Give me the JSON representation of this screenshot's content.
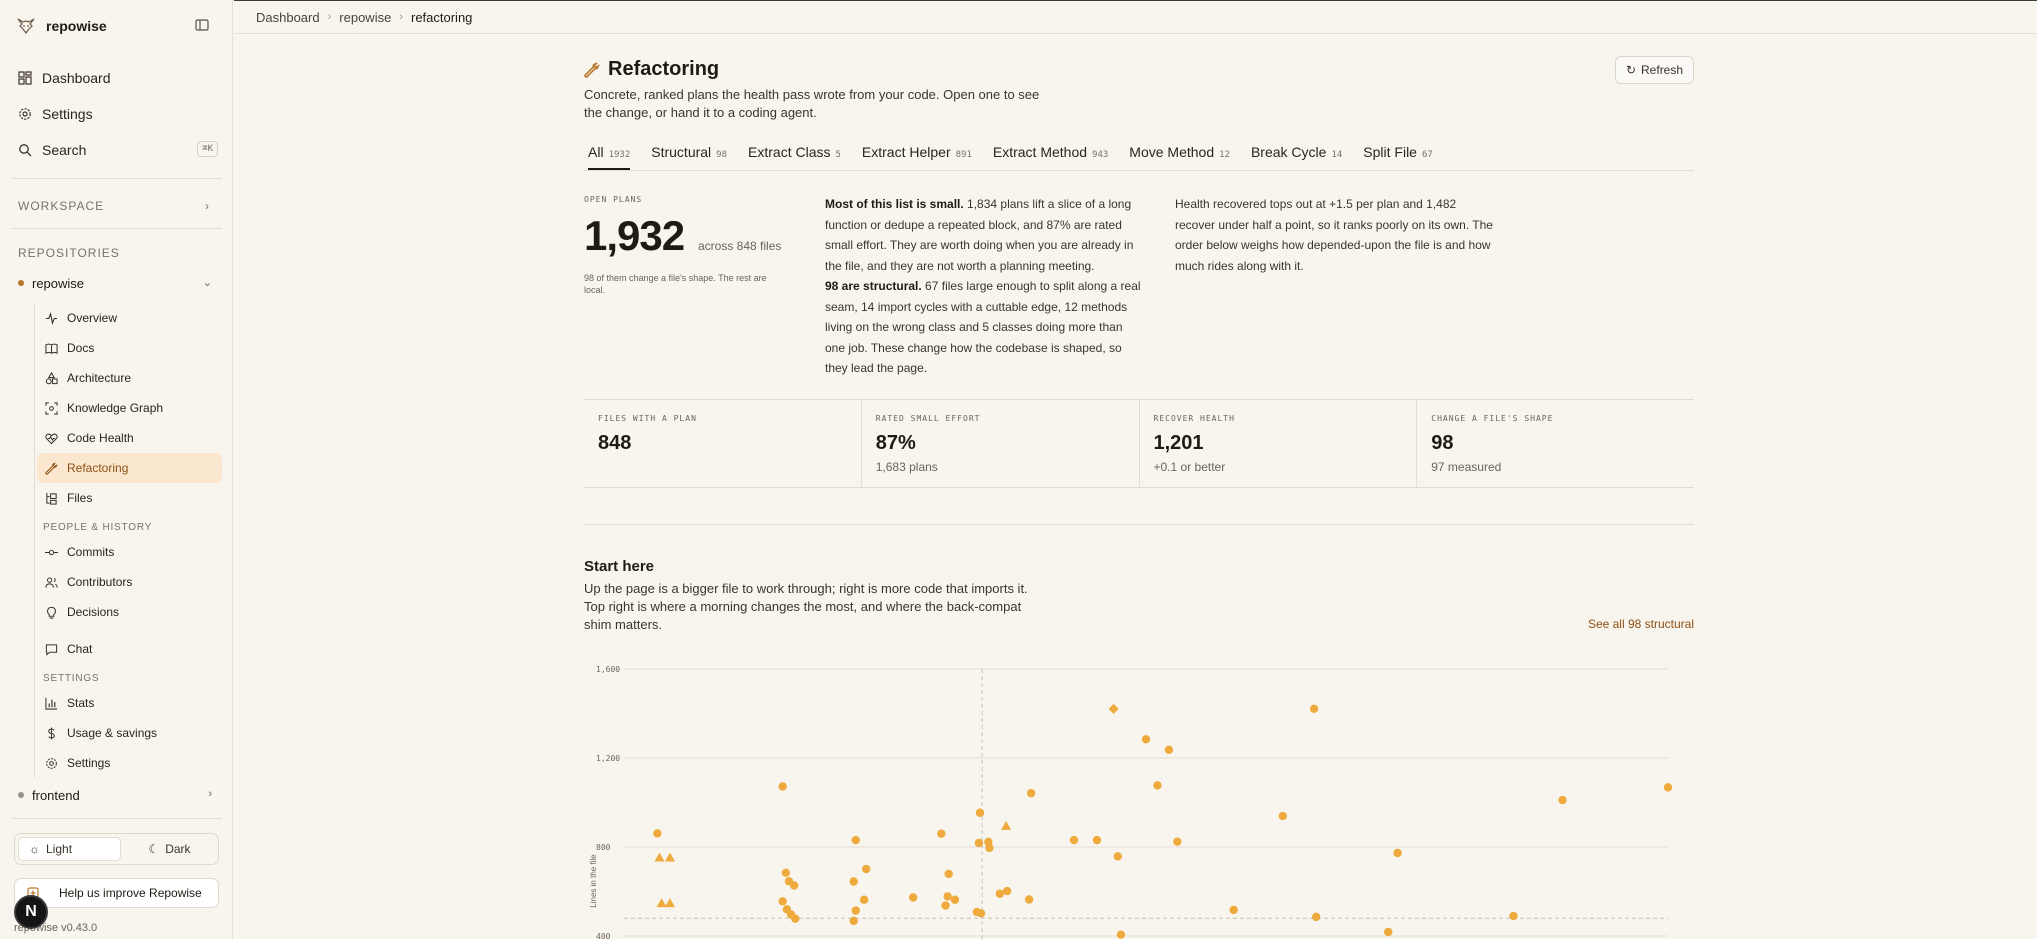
{
  "sidebar": {
    "brand": "repowise",
    "nav": [
      {
        "label": "Dashboard",
        "icon": "dashboard-icon"
      },
      {
        "label": "Settings",
        "icon": "gear-icon"
      },
      {
        "label": "Search",
        "icon": "search-icon",
        "shortcut": "⌘K"
      }
    ],
    "workspace_label": "WORKSPACE",
    "repositories_label": "REPOSITORIES",
    "repos": [
      {
        "name": "repowise",
        "expanded": true
      },
      {
        "name": "frontend",
        "expanded": false
      }
    ],
    "repo_items": [
      {
        "label": "Overview"
      },
      {
        "label": "Docs"
      },
      {
        "label": "Architecture"
      },
      {
        "label": "Knowledge Graph"
      },
      {
        "label": "Code Health"
      },
      {
        "label": "Refactoring",
        "active": true
      },
      {
        "label": "Files"
      }
    ],
    "people_label": "PEOPLE & HISTORY",
    "people_items": [
      {
        "label": "Commits"
      },
      {
        "label": "Contributors"
      },
      {
        "label": "Decisions"
      }
    ],
    "chat_label": "Chat",
    "settings_label": "SETTINGS",
    "settings_items": [
      {
        "label": "Stats"
      },
      {
        "label": "Usage & savings"
      },
      {
        "label": "Settings"
      }
    ],
    "theme": {
      "light": "Light",
      "dark": "Dark",
      "selected": "Light"
    },
    "feedback": "Help us improve Repowise",
    "version": "repowise v0.43.0",
    "avatar_initial": "N"
  },
  "breadcrumb": [
    "Dashboard",
    "repowise",
    "refactoring"
  ],
  "page": {
    "title": "Refactoring",
    "subtitle": "Concrete, ranked plans the health pass wrote from your code. Open one to see the change, or hand it to a coding agent.",
    "refresh": "Refresh",
    "tabs": [
      {
        "label": "All",
        "count": "1932",
        "active": true
      },
      {
        "label": "Structural",
        "count": "98"
      },
      {
        "label": "Extract Class",
        "count": "5"
      },
      {
        "label": "Extract Helper",
        "count": "891"
      },
      {
        "label": "Extract Method",
        "count": "943"
      },
      {
        "label": "Move Method",
        "count": "12"
      },
      {
        "label": "Break Cycle",
        "count": "14"
      },
      {
        "label": "Split File",
        "count": "67"
      }
    ],
    "open_plans_label": "OPEN PLANS",
    "open_plans_value": "1,932",
    "open_plans_across": "across 848 files",
    "open_plans_note": "98 of them change a file's shape. The rest are local.",
    "para1_lead": "Most of this list is small.",
    "para1_text": " 1,834 plans lift a slice of a long function or dedupe a repeated block, and 87% are rated small effort. They are worth doing when you are already in the file, and they are not worth a planning meeting.",
    "para2_lead": "98 are structural.",
    "para2_text": " 67 files large enough to split along a real seam, 14 import cycles with a cuttable edge, 12 methods living on the wrong class and 5 classes doing more than one job. These change how the codebase is shaped, so they lead the page.",
    "para3_text": "Health recovered tops out at +1.5 per plan and 1,482 recover under half a point, so it ranks poorly on its own. The order below weighs how depended-upon the file is and how much rides along with it.",
    "stats": [
      {
        "label": "FILES WITH A PLAN",
        "value": "848",
        "sub": ""
      },
      {
        "label": "RATED SMALL EFFORT",
        "value": "87%",
        "sub": "1,683 plans"
      },
      {
        "label": "RECOVER HEALTH",
        "value": "1,201",
        "sub": "+0.1 or better"
      },
      {
        "label": "CHANGE A FILE'S SHAPE",
        "value": "98",
        "sub": "97 measured"
      }
    ],
    "start_title": "Start here",
    "start_sub": "Up the page is a bigger file to work through; right is more code that imports it. Top right is where a morning changes the most, and where the back-compat shim matters.",
    "see_all": "See all 98 structural"
  },
  "colors": {
    "accent": "#8f4f12",
    "marker": "#eeaa3c",
    "active_bg": "#fbe7cf"
  },
  "chart_data": {
    "type": "scatter",
    "ylabel": "Lines in the file",
    "xlabel": "",
    "yticks": [
      "1,600",
      "1,200",
      "800",
      "400"
    ],
    "ylim": [
      400,
      1600
    ],
    "xlim": [
      0,
      1
    ],
    "points": [
      {
        "x": 0.032,
        "y": 861,
        "m": "circle"
      },
      {
        "x": 0.034,
        "y": 753,
        "m": "triangle"
      },
      {
        "x": 0.044,
        "y": 753,
        "m": "triangle"
      },
      {
        "x": 0.036,
        "y": 548,
        "m": "triangle"
      },
      {
        "x": 0.044,
        "y": 548,
        "m": "triangle"
      },
      {
        "x": 0.152,
        "y": 1072,
        "m": "circle"
      },
      {
        "x": 0.155,
        "y": 684,
        "m": "circle"
      },
      {
        "x": 0.158,
        "y": 646,
        "m": "circle"
      },
      {
        "x": 0.163,
        "y": 627,
        "m": "circle"
      },
      {
        "x": 0.152,
        "y": 556,
        "m": "circle"
      },
      {
        "x": 0.156,
        "y": 520,
        "m": "circle"
      },
      {
        "x": 0.16,
        "y": 497,
        "m": "circle"
      },
      {
        "x": 0.164,
        "y": 478,
        "m": "circle"
      },
      {
        "x": 0.222,
        "y": 831,
        "m": "circle"
      },
      {
        "x": 0.232,
        "y": 701,
        "m": "circle"
      },
      {
        "x": 0.22,
        "y": 645,
        "m": "circle"
      },
      {
        "x": 0.23,
        "y": 563,
        "m": "circle"
      },
      {
        "x": 0.222,
        "y": 514,
        "m": "circle"
      },
      {
        "x": 0.22,
        "y": 468,
        "m": "circle"
      },
      {
        "x": 0.277,
        "y": 573,
        "m": "circle"
      },
      {
        "x": 0.304,
        "y": 860,
        "m": "circle"
      },
      {
        "x": 0.311,
        "y": 679,
        "m": "circle"
      },
      {
        "x": 0.31,
        "y": 578,
        "m": "circle"
      },
      {
        "x": 0.317,
        "y": 563,
        "m": "circle"
      },
      {
        "x": 0.308,
        "y": 537,
        "m": "circle"
      },
      {
        "x": 0.341,
        "y": 954,
        "m": "circle"
      },
      {
        "x": 0.34,
        "y": 818,
        "m": "circle"
      },
      {
        "x": 0.349,
        "y": 823,
        "m": "circle"
      },
      {
        "x": 0.35,
        "y": 796,
        "m": "circle"
      },
      {
        "x": 0.338,
        "y": 508,
        "m": "circle"
      },
      {
        "x": 0.342,
        "y": 502,
        "m": "circle"
      },
      {
        "x": 0.36,
        "y": 590,
        "m": "circle"
      },
      {
        "x": 0.367,
        "y": 602,
        "m": "circle"
      },
      {
        "x": 0.366,
        "y": 895,
        "m": "triangle"
      },
      {
        "x": 0.39,
        "y": 1042,
        "m": "circle"
      },
      {
        "x": 0.388,
        "y": 564,
        "m": "circle"
      },
      {
        "x": 0.431,
        "y": 831,
        "m": "circle"
      },
      {
        "x": 0.453,
        "y": 831,
        "m": "circle"
      },
      {
        "x": 0.469,
        "y": 1421,
        "m": "diamond"
      },
      {
        "x": 0.473,
        "y": 758,
        "m": "circle"
      },
      {
        "x": 0.5,
        "y": 1284,
        "m": "circle"
      },
      {
        "x": 0.511,
        "y": 1077,
        "m": "circle"
      },
      {
        "x": 0.522,
        "y": 1237,
        "m": "circle"
      },
      {
        "x": 0.53,
        "y": 824,
        "m": "circle"
      },
      {
        "x": 0.476,
        "y": 406,
        "m": "circle"
      },
      {
        "x": 0.584,
        "y": 517,
        "m": "circle"
      },
      {
        "x": 0.631,
        "y": 939,
        "m": "circle"
      },
      {
        "x": 0.661,
        "y": 1421,
        "m": "circle"
      },
      {
        "x": 0.663,
        "y": 486,
        "m": "circle"
      },
      {
        "x": 0.741,
        "y": 773,
        "m": "circle"
      },
      {
        "x": 0.732,
        "y": 418,
        "m": "circle"
      },
      {
        "x": 0.852,
        "y": 490,
        "m": "circle"
      },
      {
        "x": 0.899,
        "y": 1011,
        "m": "circle"
      },
      {
        "x": 1.0,
        "y": 1068,
        "m": "circle"
      }
    ],
    "ref_x": 0.343,
    "ref_y": 480
  }
}
